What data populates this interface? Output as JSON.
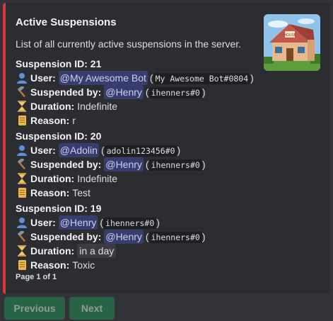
{
  "embed": {
    "accent_color": "#e0363a",
    "title": "Active Suspensions",
    "description": "List of all currently active suspensions in the server.",
    "thumbnail_icon": "house-image",
    "footer": "Page 1 of 1"
  },
  "labels": {
    "user": "User:",
    "suspended_by": "Suspended by:",
    "duration": "Duration:",
    "reason": "Reason:"
  },
  "suspensions": [
    {
      "header": "Suspension ID: 21",
      "user_mention": "@My Awesome Bot",
      "user_tag": "My Awesome Bot#0804",
      "by_mention": "@Henry",
      "by_tag": "ihenners#0",
      "duration": "Indefinite",
      "reason": "r"
    },
    {
      "header": "Suspension ID: 20",
      "user_mention": "@Adolin",
      "user_tag": "adolin123456#0",
      "by_mention": "@Henry",
      "by_tag": "ihenners#0",
      "duration": "Indefinite",
      "reason": "Test"
    },
    {
      "header": "Suspension ID: 19",
      "user_mention": "@Henry",
      "user_tag": "ihenners#0",
      "by_mention": "@Henry",
      "by_tag": "ihenners#0",
      "duration": "in a day",
      "reason": "Toxic"
    }
  ],
  "buttons": {
    "previous": "Previous",
    "next": "Next",
    "color": "#24834f"
  }
}
